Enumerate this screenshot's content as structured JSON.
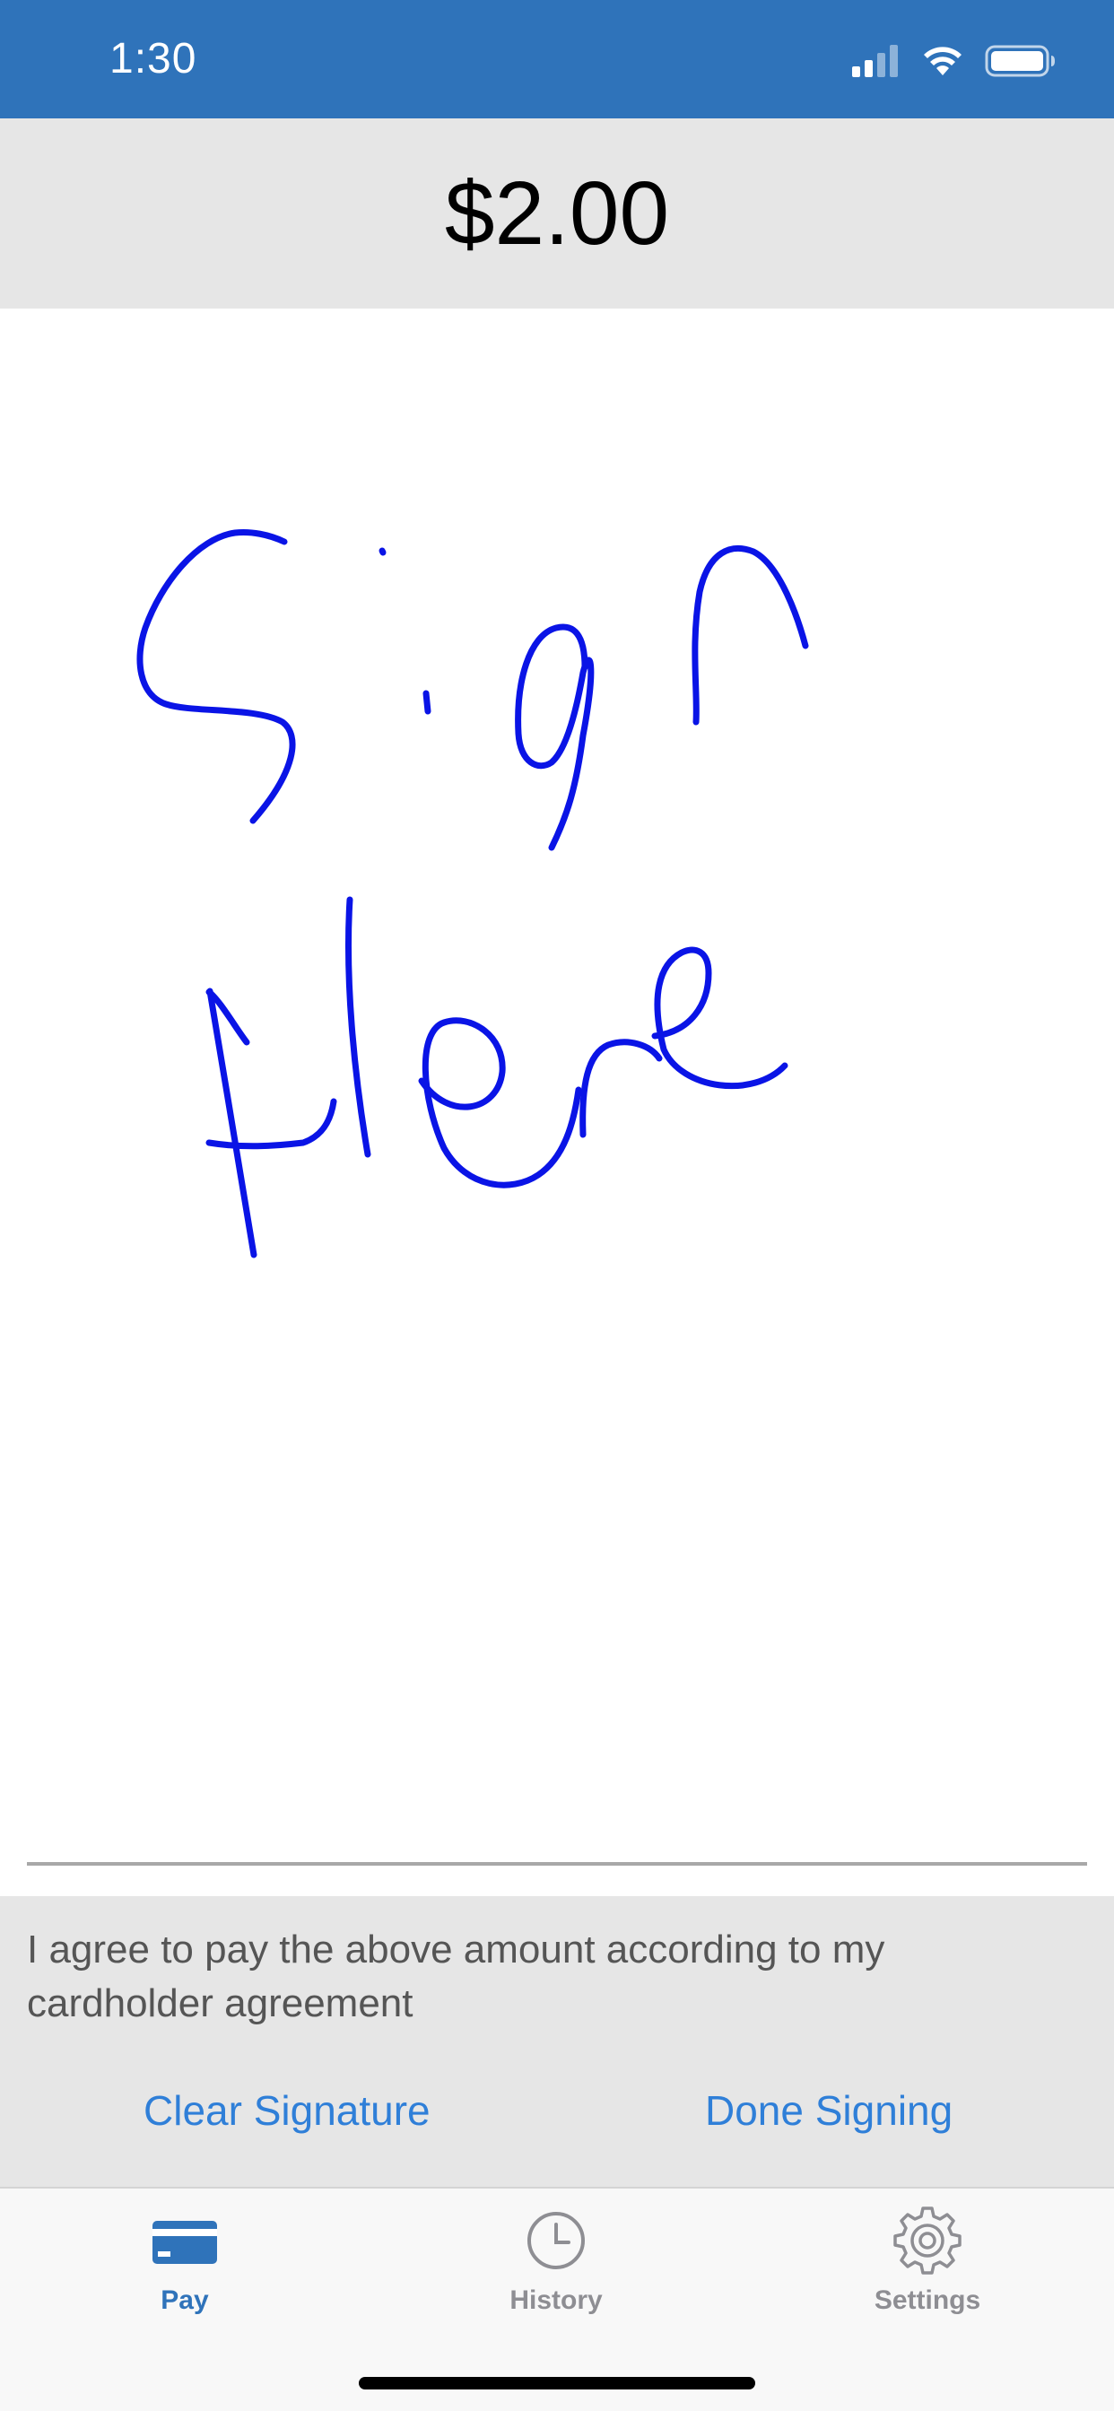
{
  "status_bar": {
    "time": "1:30",
    "signal_icon": "cellular-signal-icon",
    "wifi_icon": "wifi-icon",
    "battery_icon": "battery-icon",
    "background_color": "#2f73ba"
  },
  "header": {
    "amount": "$2.00"
  },
  "signature": {
    "ink_color": "#0a14e6",
    "handwritten_content": "Sign Here"
  },
  "agreement": {
    "text": "I agree to pay the above amount according to my cardholder agreement",
    "clear_label": "Clear Signature",
    "done_label": "Done Signing",
    "link_color": "#2f7fd8"
  },
  "tab_bar": {
    "items": [
      {
        "label": "Pay",
        "icon": "credit-card-icon",
        "active": true
      },
      {
        "label": "History",
        "icon": "clock-icon",
        "active": false
      },
      {
        "label": "Settings",
        "icon": "gear-icon",
        "active": false
      }
    ],
    "active_color": "#2f73ba",
    "inactive_color": "#8e8e93"
  }
}
